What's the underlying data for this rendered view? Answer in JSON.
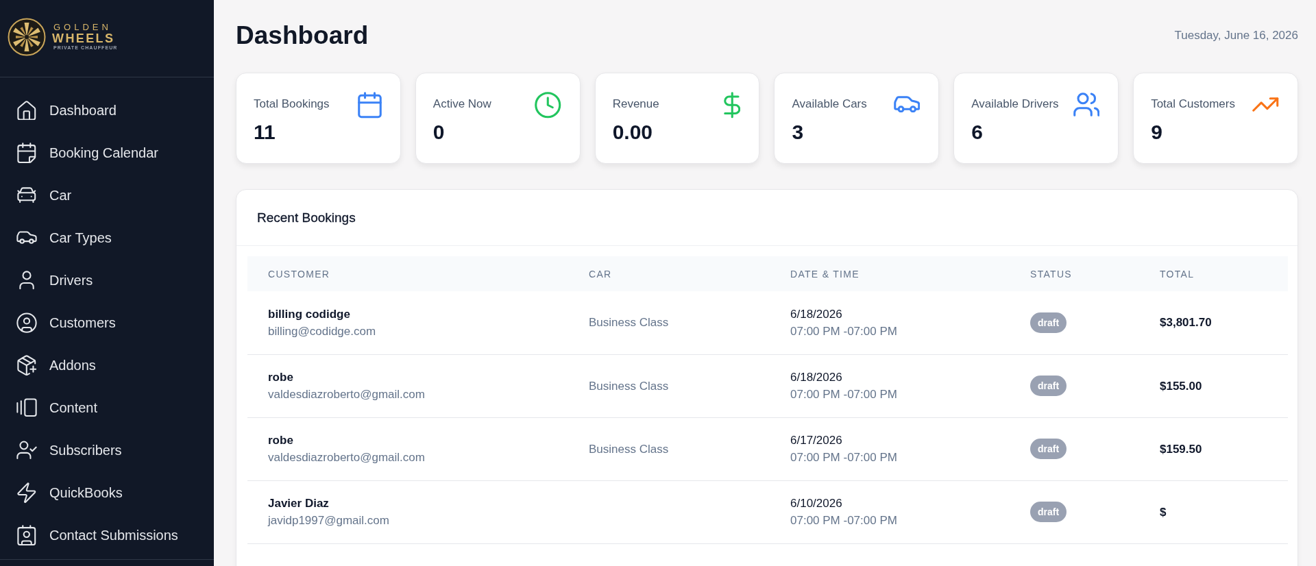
{
  "sidebar": {
    "brand": {
      "top": "GOLDEN",
      "bottom": "WHEELS",
      "tagline": "PRIVATE CHAUFFEUR"
    },
    "items": [
      {
        "label": "Dashboard"
      },
      {
        "label": "Booking Calendar"
      },
      {
        "label": "Car"
      },
      {
        "label": "Car Types"
      },
      {
        "label": "Drivers"
      },
      {
        "label": "Customers"
      },
      {
        "label": "Addons"
      },
      {
        "label": "Content"
      },
      {
        "label": "Subscribers"
      },
      {
        "label": "QuickBooks"
      },
      {
        "label": "Contact Submissions"
      }
    ]
  },
  "header": {
    "title": "Dashboard",
    "date": "Tuesday, June 16, 2026"
  },
  "stats": [
    {
      "label": "Total Bookings",
      "value": "11",
      "color": "#3b82f6"
    },
    {
      "label": "Active Now",
      "value": "0",
      "color": "#22c55e"
    },
    {
      "label": "Revenue",
      "value": "0.00",
      "color": "#22c55e"
    },
    {
      "label": "Available Cars",
      "value": "3",
      "color": "#3b82f6"
    },
    {
      "label": "Available Drivers",
      "value": "6",
      "color": "#3b82f6"
    },
    {
      "label": "Total Customers",
      "value": "9",
      "color": "#f97316"
    }
  ],
  "recent_bookings": {
    "title": "Recent Bookings",
    "columns": [
      "CUSTOMER",
      "CAR",
      "DATE & TIME",
      "STATUS",
      "TOTAL"
    ],
    "rows": [
      {
        "customer": "billing codidge",
        "email": "billing@codidge.com",
        "car": "Business Class",
        "date": "6/18/2026",
        "time": "07:00 PM -07:00 PM",
        "status": "draft",
        "total": "$3,801.70"
      },
      {
        "customer": "robe",
        "email": "valdesdiazroberto@gmail.com",
        "car": "Business Class",
        "date": "6/18/2026",
        "time": "07:00 PM -07:00 PM",
        "status": "draft",
        "total": "$155.00"
      },
      {
        "customer": "robe",
        "email": "valdesdiazroberto@gmail.com",
        "car": "Business Class",
        "date": "6/17/2026",
        "time": "07:00 PM -07:00 PM",
        "status": "draft",
        "total": "$159.50"
      },
      {
        "customer": "Javier Diaz",
        "email": "javidp1997@gmail.com",
        "date": "6/10/2026",
        "time": "07:00 PM -07:00 PM",
        "status": "draft",
        "total": "$"
      }
    ]
  }
}
